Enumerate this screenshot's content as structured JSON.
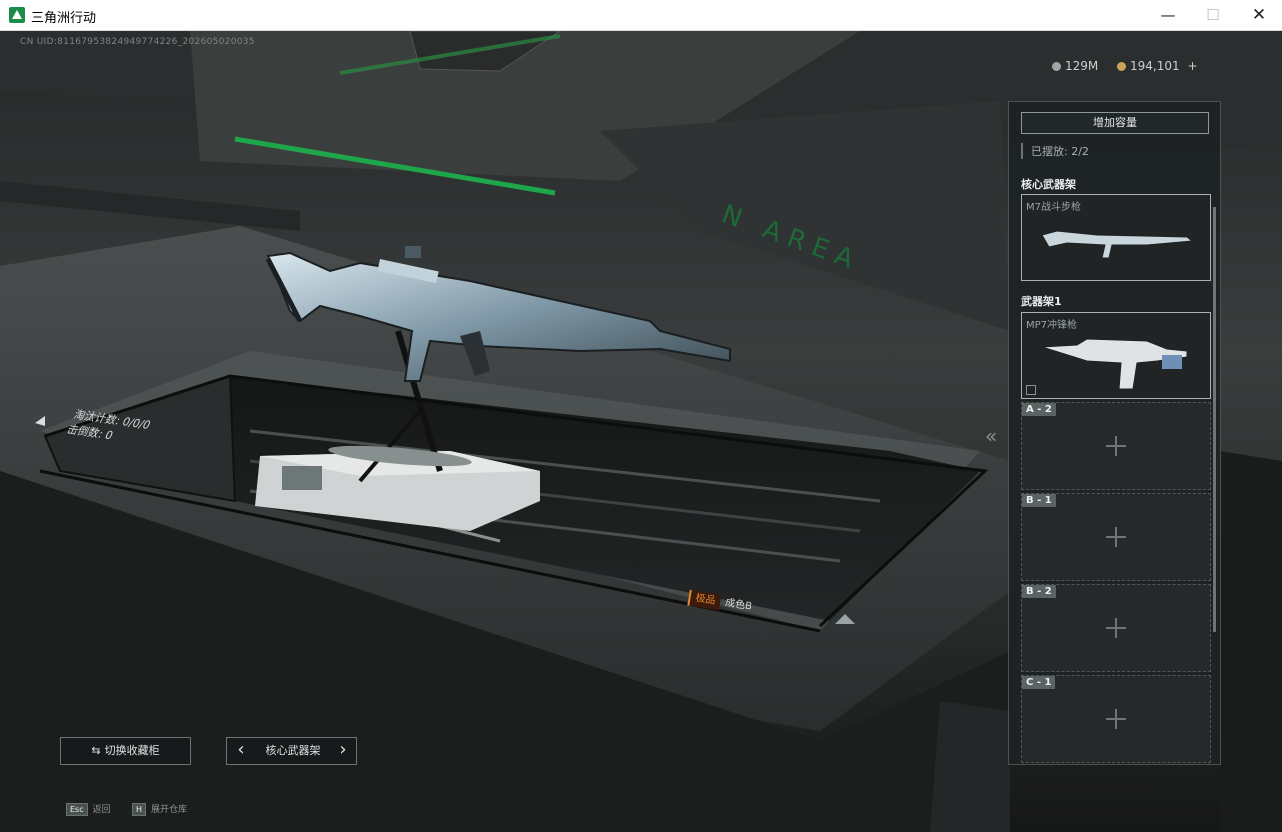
{
  "window": {
    "title": "三角洲行动",
    "minimize": "—",
    "maximize": "☐",
    "close": "✕"
  },
  "hud": {
    "uid": "CN UID:811679538249497742​26_202605020035",
    "currency_silver": "129M",
    "currency_gold": "194,101",
    "add": "+"
  },
  "panel": {
    "expand_button": "增加容量",
    "placed": "已摆放: 2/2",
    "core_rack_title": "核心武器架",
    "core_rack_weapon": "M7战斗步枪",
    "rack1_title": "武器架1",
    "rack1_weapon": "MP7冲锋枪",
    "empty_slots": [
      "A - 2",
      "B - 1",
      "B - 2",
      "C - 1"
    ]
  },
  "display": {
    "line1": "淘汰计数: 0/0/0",
    "line2": "击倒数: 0",
    "grade": "极品",
    "status": "成色B",
    "floor_text": "N AREA"
  },
  "controls": {
    "switch_cabinet": "切换收藏柜",
    "rack_prev": "‹",
    "rack_name": "核心武器架",
    "rack_next": "›"
  },
  "hints": {
    "esc_key": "Esc",
    "esc_label": "返回",
    "h_key": "H",
    "h_label": "展开仓库"
  },
  "colors": {
    "accent_green": "#1fa64a",
    "grade_orange": "#e08a30"
  }
}
